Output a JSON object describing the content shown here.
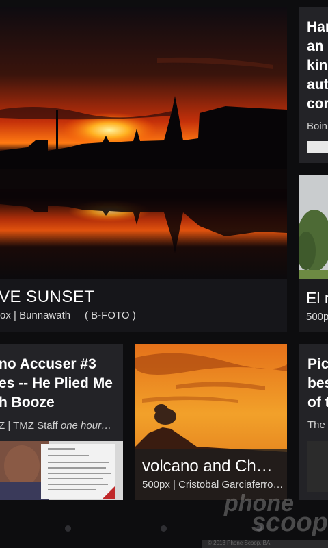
{
  "cards": {
    "sunset": {
      "title": "VE SUNSET",
      "source": "ox | Bunnawath",
      "credit": "( B-FOTO )"
    },
    "right_top": {
      "headline": "Har an kin aut cor",
      "source": "Boin"
    },
    "right_mid": {
      "title": "El r",
      "source": "500p"
    },
    "tmz": {
      "headline": "no Accuser #3 es -- He Plied Me h Booze",
      "source_prefix": "Z | TMZ Staff ",
      "source_time": "one hour…"
    },
    "volcano": {
      "title": "volcano and Ch…",
      "source": "500px | Cristobal Garciaferro…"
    },
    "right_bot": {
      "headline": "Pic bes of t",
      "source": "The"
    }
  },
  "watermark": {
    "line1": "phone",
    "line2": "scoop"
  },
  "bottom_strip_text": "© 2013 Phone Scoop, BA",
  "colors": {
    "background": "#0d0d0f",
    "card": "#232327",
    "sunset_orange": "#ff6a00"
  },
  "pager": {
    "dots": 3
  }
}
